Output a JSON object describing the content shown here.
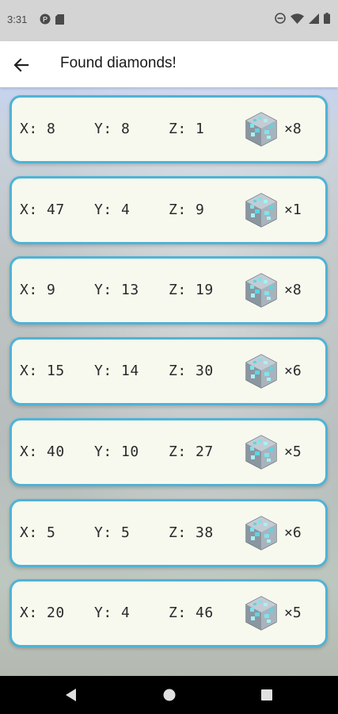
{
  "status_bar": {
    "time": "3:31",
    "left_icons": [
      "notification-p-icon",
      "sd-card-icon"
    ],
    "right_icons": [
      "do-not-disturb-icon",
      "wifi-icon",
      "cellular-icon",
      "battery-icon"
    ]
  },
  "app_bar": {
    "title": "Found diamonds!"
  },
  "colors": {
    "card_border": "#4fb3d6",
    "card_background": "#f7f9ee",
    "diamond": "#7fe3ec"
  },
  "finds": [
    {
      "x": "X: 8",
      "y": "Y: 8",
      "z": "Z: 1",
      "count": "×8"
    },
    {
      "x": "X: 47",
      "y": "Y: 4",
      "z": "Z: 9",
      "count": "×1"
    },
    {
      "x": "X: 9",
      "y": "Y: 13",
      "z": "Z: 19",
      "count": "×8"
    },
    {
      "x": "X: 15",
      "y": "Y: 14",
      "z": "Z: 30",
      "count": "×6"
    },
    {
      "x": "X: 40",
      "y": "Y: 10",
      "z": "Z: 27",
      "count": "×5"
    },
    {
      "x": "X: 5",
      "y": "Y: 5",
      "z": "Z: 38",
      "count": "×6"
    },
    {
      "x": "X: 20",
      "y": "Y: 4",
      "z": "Z: 46",
      "count": "×5"
    }
  ],
  "nav_bar": {
    "buttons": [
      "back-triangle-icon",
      "home-circle-icon",
      "recents-square-icon"
    ]
  }
}
